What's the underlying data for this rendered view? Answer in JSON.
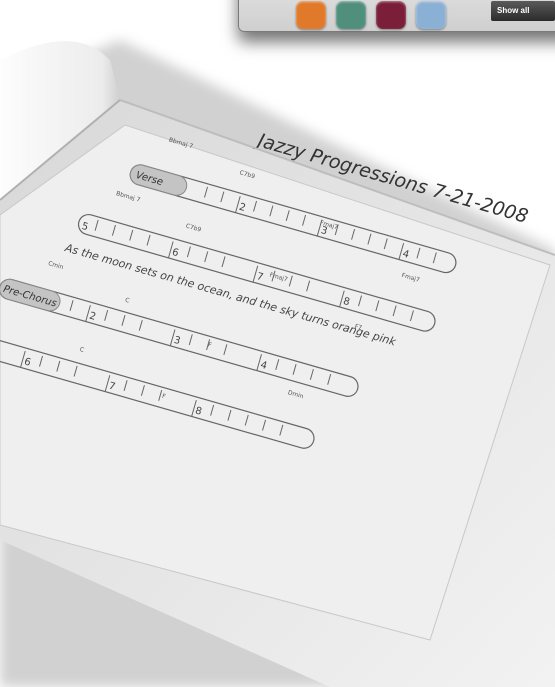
{
  "window": {
    "show_label": "Show all",
    "colors": [
      "#e07a2a",
      "#4f8f7c",
      "#7a1e3a",
      "#8ab0d6"
    ]
  },
  "sheet": {
    "title": "Jazzy Progressions 7-21-2008",
    "lyric": "As the moon sets on the ocean, and the sky turns orange pink",
    "sections": {
      "verse": "Verse",
      "prechorus": "Pre-Chorus"
    },
    "chords": [
      "Bbmaj 7",
      "C7b9",
      "Fmaj7",
      "Fmaj7",
      "Bbmaj 7",
      "C7b9",
      "Fmaj7",
      "F7",
      "Cmin",
      "C",
      "F",
      "Dmin",
      "C",
      "F"
    ],
    "measures": [
      "2",
      "3",
      "4",
      "5",
      "6",
      "7",
      "8",
      "2",
      "3",
      "4",
      "6",
      "7",
      "8"
    ]
  }
}
